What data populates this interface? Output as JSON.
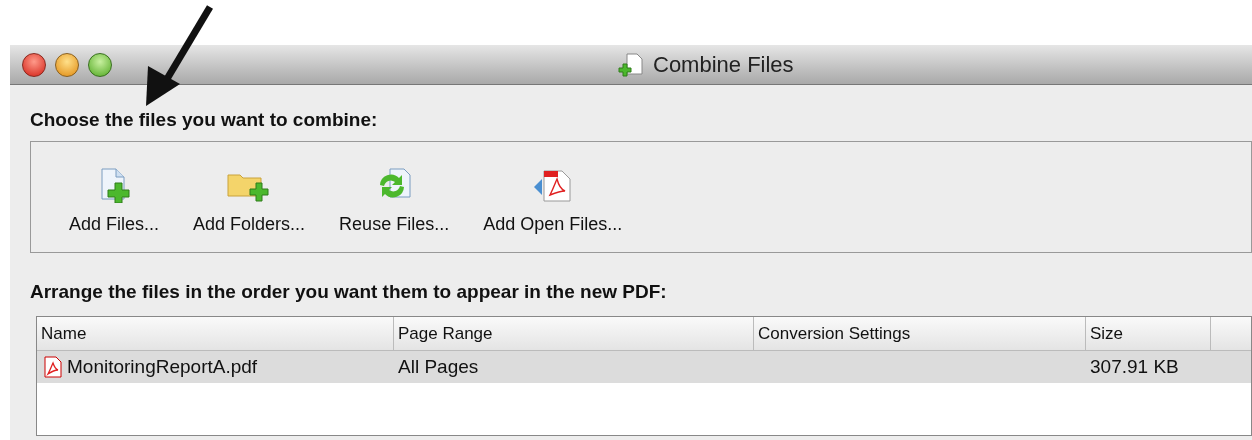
{
  "window": {
    "title": "Combine Files"
  },
  "files_section": {
    "label": "Choose the files you want to combine:",
    "tools": [
      {
        "kind": "add-files",
        "label": "Add Files..."
      },
      {
        "kind": "add-folders",
        "label": "Add Folders..."
      },
      {
        "kind": "reuse-files",
        "label": "Reuse Files..."
      },
      {
        "kind": "add-open-files",
        "label": "Add Open Files..."
      }
    ]
  },
  "order_section": {
    "label": "Arrange the files in the order you want them to appear in the new PDF:",
    "table": {
      "columns": [
        "Name",
        "Page Range",
        "Conversion Settings",
        "Size"
      ],
      "rows": [
        {
          "name": "MonitoringReportA.pdf",
          "page_range": "All Pages",
          "size": "307.91 KB",
          "selected": true
        }
      ]
    }
  }
}
